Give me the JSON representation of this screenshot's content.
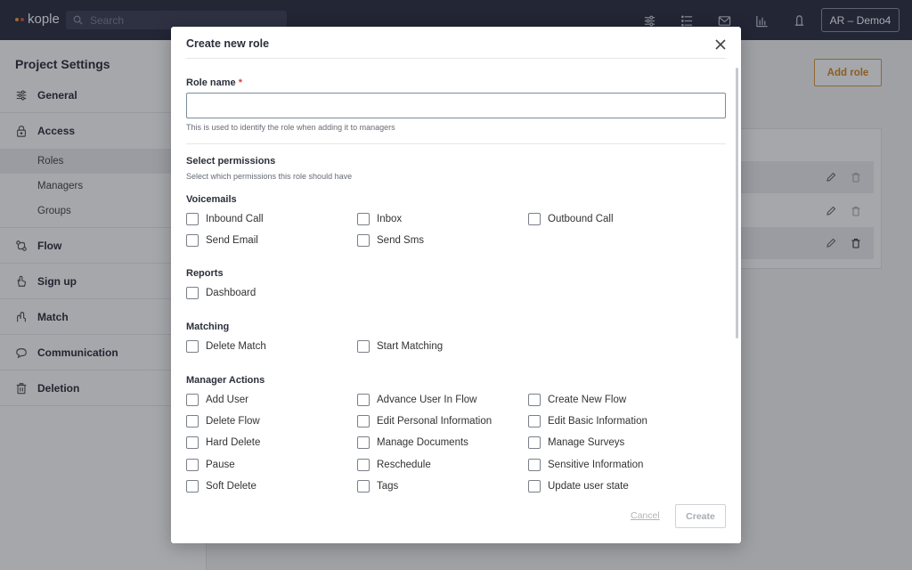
{
  "topbar": {
    "logo_text": "kople",
    "search_placeholder": "Search",
    "account_label": "AR – Demo4",
    "icons": [
      "sliders-icon",
      "list-icon",
      "mail-icon",
      "bar-chart-icon",
      "bell-icon"
    ]
  },
  "sidebar": {
    "title": "Project Settings",
    "items": [
      {
        "label": "General",
        "icon": "sliders-icon"
      },
      {
        "label": "Access",
        "icon": "lock-icon",
        "sub": [
          "Roles",
          "Managers",
          "Groups"
        ]
      },
      {
        "label": "Flow",
        "icon": "flow-icon"
      },
      {
        "label": "Sign up",
        "icon": "hand-icon"
      },
      {
        "label": "Match",
        "icon": "match-icon"
      },
      {
        "label": "Communication",
        "icon": "chat-icon"
      },
      {
        "label": "Deletion",
        "icon": "trash-icon"
      }
    ]
  },
  "main": {
    "add_role_label": "Add role"
  },
  "modal": {
    "title": "Create new role",
    "role_name_label": "Role name",
    "required_mark": "*",
    "role_name_value": "",
    "role_name_help": "This is used to identify the role when adding it to managers",
    "permissions_title": "Select permissions",
    "permissions_subtitle": "Select which permissions this role should have",
    "groups": [
      {
        "title": "Voicemails",
        "items": [
          "Inbound Call",
          "Inbox",
          "Outbound Call",
          "Send Email",
          "Send Sms"
        ]
      },
      {
        "title": "Reports",
        "items": [
          "Dashboard"
        ]
      },
      {
        "title": "Matching",
        "items": [
          "Delete Match",
          "Start Matching"
        ]
      },
      {
        "title": "Manager Actions",
        "items": [
          "Add User",
          "Advance User In Flow",
          "Create New Flow",
          "Delete Flow",
          "Edit Personal Information",
          "Edit Basic Information",
          "Hard Delete",
          "Manage Documents",
          "Manage Surveys",
          "Pause",
          "Reschedule",
          "Sensitive Information",
          "Soft Delete",
          "Tags",
          "Update user state"
        ]
      }
    ],
    "cancel_label": "Cancel",
    "create_label": "Create"
  }
}
